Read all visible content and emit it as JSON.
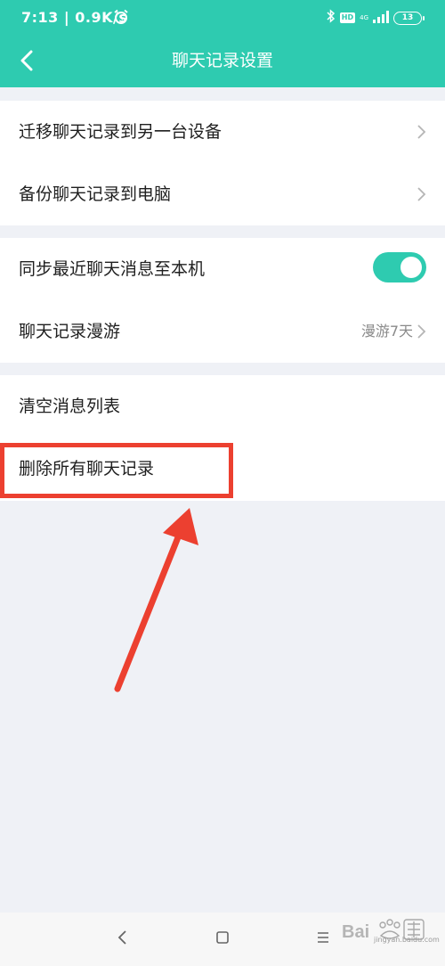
{
  "status_bar": {
    "time_speed": "7:13 | 0.9K/s",
    "network": "4G",
    "hd": "HD",
    "battery": "13"
  },
  "header": {
    "title": "聊天记录设置"
  },
  "groups": [
    {
      "items": [
        {
          "label": "迁移聊天记录到另一台设备"
        },
        {
          "label": "备份聊天记录到电脑"
        }
      ]
    },
    {
      "items": [
        {
          "label": "同步最近聊天消息至本机",
          "toggle_on": true
        },
        {
          "label": "聊天记录漫游",
          "value": "漫游7天"
        }
      ]
    },
    {
      "items": [
        {
          "label": "清空消息列表"
        },
        {
          "label": "删除所有聊天记录"
        }
      ]
    }
  ],
  "annotation": {
    "color": "#ec4030"
  },
  "watermark": {
    "text": "jingyan.baidu.com"
  },
  "colors": {
    "accent": "#2ecbb0",
    "background": "#eff1f6"
  }
}
